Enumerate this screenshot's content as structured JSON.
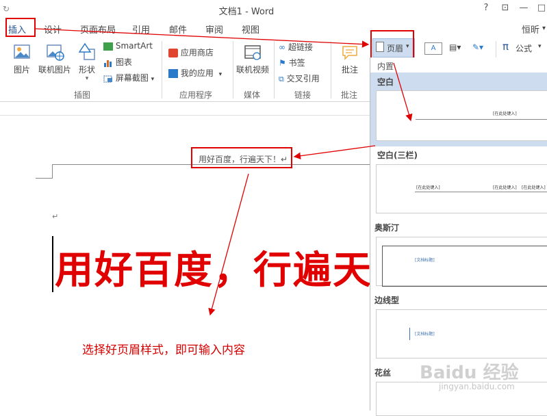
{
  "window": {
    "title": "文档1 - Word",
    "help": "?",
    "restore": "⊡",
    "minimize": "—",
    "maximize": "□"
  },
  "tabs": [
    {
      "label": "插入"
    },
    {
      "label": "设计"
    },
    {
      "label": "页面布局"
    },
    {
      "label": "引用"
    },
    {
      "label": "邮件"
    },
    {
      "label": "审阅"
    },
    {
      "label": "视图"
    }
  ],
  "user": "恒昕",
  "ribbon": {
    "picture": "图片",
    "online_picture": "联机图片",
    "shapes": "形状",
    "smartart": "SmartArt",
    "chart": "图表",
    "screenshot": "屏幕截图",
    "group_illustrations": "插图",
    "store": "应用商店",
    "my_apps": "我的应用",
    "group_apps": "应用程序",
    "online_video": "联机视频",
    "group_media": "媒体",
    "hyperlink": "超链接",
    "bookmark": "书签",
    "cross_ref": "交叉引用",
    "group_links": "链接",
    "comment": "批注",
    "group_comments": "批注",
    "header": "页眉",
    "equation": "公式"
  },
  "document": {
    "header_text": "用好百度，行遍天下！↵",
    "body_large_text": "用好百度，行遍天",
    "paragraph_mark": "↵",
    "annotation": "选择好页眉样式，即可输入内容"
  },
  "gallery": {
    "section": "内置",
    "items": [
      {
        "name": "空白",
        "placeholders": [
          "[在此处键入]"
        ]
      },
      {
        "name": "空白(三栏)",
        "placeholders": [
          "[在此处键入]",
          "[在此处键入]",
          "[在此处键入]"
        ]
      },
      {
        "name": "奥斯汀",
        "placeholders": [
          "[文档标题]"
        ]
      },
      {
        "name": "边线型",
        "placeholders": [
          "[文档标题]"
        ]
      },
      {
        "name": "花丝",
        "placeholders": []
      }
    ]
  },
  "watermark": {
    "logo": "Baidu 经验",
    "url": "jingyan.baidu.com"
  },
  "colors": {
    "annotation_red": "#e00000",
    "tab_blue": "#2b579a",
    "selected_bg": "#cddcee"
  }
}
